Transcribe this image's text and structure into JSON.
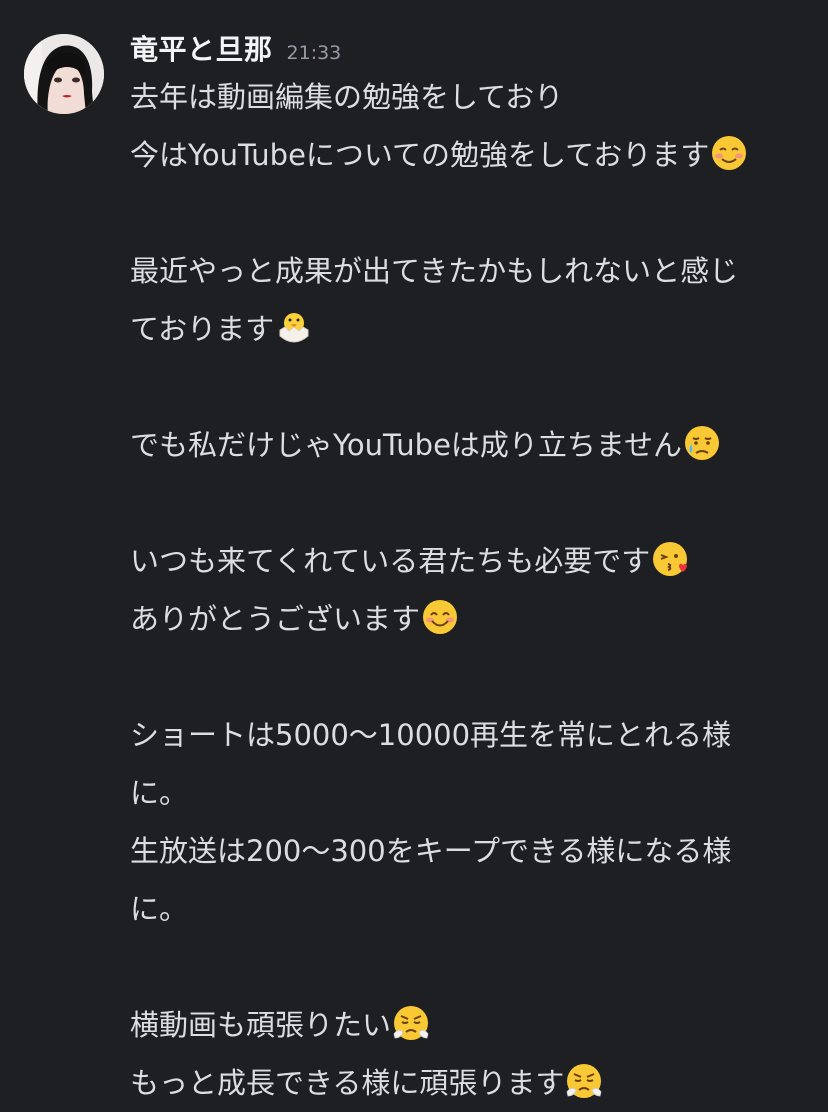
{
  "message": {
    "username": "竜平と旦那",
    "timestamp": "21:33",
    "avatar_icon": "user-avatar-photo",
    "lines": [
      {
        "text": "去年は動画編集の勉強をしており",
        "emoji": ""
      },
      {
        "text": "今はYouTubeについての勉強をしております",
        "emoji": "smiling-face-icon"
      },
      {
        "text": "",
        "emoji": ""
      },
      {
        "text": "最近やっと成果が出てきたかもしれないと感じ",
        "emoji": ""
      },
      {
        "text": "ております",
        "emoji": "hatching-chick-icon"
      },
      {
        "text": "",
        "emoji": ""
      },
      {
        "text": "でも私だけじゃYouTubeは成り立ちません",
        "emoji": "sad-relieved-face-icon"
      },
      {
        "text": "",
        "emoji": ""
      },
      {
        "text": "いつも来てくれている君たちも必要です",
        "emoji": "kissing-heart-face-icon"
      },
      {
        "text": "ありがとうございます",
        "emoji": "smiling-eyes-face-icon"
      },
      {
        "text": "",
        "emoji": ""
      },
      {
        "text": "ショートは5000〜10000再生を常にとれる様",
        "emoji": ""
      },
      {
        "text": "に。",
        "emoji": ""
      },
      {
        "text": "生放送は200〜300をキープできる様になる様",
        "emoji": ""
      },
      {
        "text": "に。",
        "emoji": ""
      },
      {
        "text": "",
        "emoji": ""
      },
      {
        "text": "横動画も頑張りたい",
        "emoji": "triumph-face-icon"
      },
      {
        "text": "もっと成長できる様に頑張ります",
        "emoji": "triumph-face-icon"
      }
    ]
  },
  "colors": {
    "background": "#1e1f22",
    "username": "#f2f3f5",
    "timestamp": "#949ba4",
    "text": "#dbdee1"
  }
}
